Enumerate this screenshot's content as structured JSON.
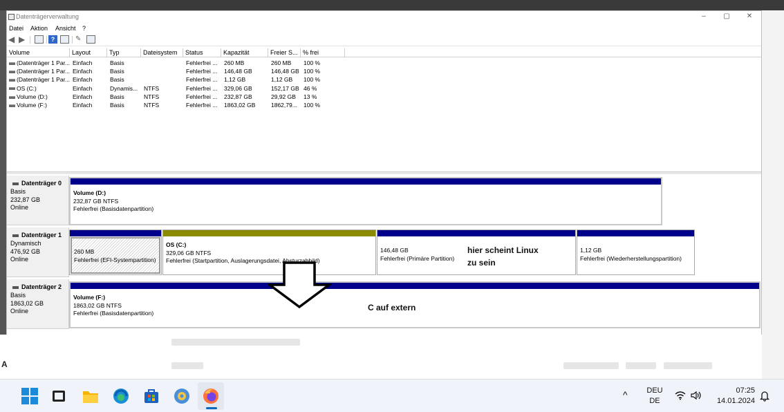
{
  "window": {
    "title": "Datenträgerverwaltung",
    "controls": {
      "minimize": "–",
      "maximize": "▢",
      "close": "✕"
    }
  },
  "menu": [
    "Datei",
    "Aktion",
    "Ansicht",
    "?"
  ],
  "toolbar_icons": [
    "back-icon",
    "forward-icon",
    "console-tree-icon",
    "properties-icon",
    "help-icon",
    "view-icon",
    "connect-icon",
    "settings-icon"
  ],
  "columns": [
    "Volume",
    "Layout",
    "Typ",
    "Dateisystem",
    "Status",
    "Kapazität",
    "Freier S...",
    "% frei"
  ],
  "volumes": [
    {
      "volume": "(Datenträger 1 Par...",
      "layout": "Einfach",
      "typ": "Basis",
      "dateisystem": "",
      "status": "Fehlerfrei ...",
      "kapazitaet": "260 MB",
      "frei": "260 MB",
      "prozent": "100 %"
    },
    {
      "volume": "(Datenträger 1 Par...",
      "layout": "Einfach",
      "typ": "Basis",
      "dateisystem": "",
      "status": "Fehlerfrei ...",
      "kapazitaet": "146,48 GB",
      "frei": "146,48 GB",
      "prozent": "100 %"
    },
    {
      "volume": "(Datenträger 1 Par...",
      "layout": "Einfach",
      "typ": "Basis",
      "dateisystem": "",
      "status": "Fehlerfrei ...",
      "kapazitaet": "1,12 GB",
      "frei": "1,12 GB",
      "prozent": "100 %"
    },
    {
      "volume": "OS (C:)",
      "layout": "Einfach",
      "typ": "Dynamis...",
      "dateisystem": "NTFS",
      "status": "Fehlerfrei ...",
      "kapazitaet": "329,06 GB",
      "frei": "152,17 GB",
      "prozent": "46 %"
    },
    {
      "volume": "Volume (D:)",
      "layout": "Einfach",
      "typ": "Basis",
      "dateisystem": "NTFS",
      "status": "Fehlerfrei ...",
      "kapazitaet": "232,87 GB",
      "frei": "29,92 GB",
      "prozent": "13 %"
    },
    {
      "volume": "Volume (F:)",
      "layout": "Einfach",
      "typ": "Basis",
      "dateisystem": "NTFS",
      "status": "Fehlerfrei ...",
      "kapazitaet": "1863,02 GB",
      "frei": "1862,79...",
      "prozent": "100 %"
    }
  ],
  "disks": [
    {
      "name": "Datenträger 0",
      "type": "Basis",
      "size": "232,87 GB",
      "state": "Online",
      "partitions": [
        {
          "title": "Volume  (D:)",
          "size": "232,87 GB NTFS",
          "status": "Fehlerfrei (Basisdatenpartition)",
          "bar_color": "#00008b"
        }
      ]
    },
    {
      "name": "Datenträger 1",
      "type": "Dynamisch",
      "size": "476,92 GB",
      "state": "Online",
      "partitions": [
        {
          "title": "",
          "size": "260 MB",
          "status": "Fehlerfrei (EFI-Systempartition)",
          "bar_color": "#00008b"
        },
        {
          "title": "OS  (C:)",
          "size": "329,06 GB NTFS",
          "status": "Fehlerfrei (Startpartition, Auslagerungsdatei, Absturzabbild)",
          "bar_color": "#8b8b00"
        },
        {
          "title": "",
          "size": "146,48 GB",
          "status": "Fehlerfrei (Primäre Partition)",
          "bar_color": "#00008b"
        },
        {
          "title": "",
          "size": "1,12 GB",
          "status": "Fehlerfrei (Wiederherstellungspartition)",
          "bar_color": "#00008b"
        }
      ]
    },
    {
      "name": "Datenträger 2",
      "type": "Basis",
      "size": "1863,02 GB",
      "state": "Online",
      "partitions": [
        {
          "title": "Volume  (F:)",
          "size": "1863,02 GB NTFS",
          "status": "Fehlerfrei (Basisdatenpartition)",
          "bar_color": "#00008b"
        }
      ]
    }
  ],
  "annotations": {
    "linux_line1": "hier scheint Linux",
    "linux_line2": "zu sein",
    "c_extern": "C auf extern"
  },
  "desktop": {
    "partial_letter": "A"
  },
  "taskbar": {
    "apps": [
      "windows-start-icon",
      "task-view-icon",
      "file-explorer-icon",
      "edge-icon",
      "store-icon",
      "settings-icon",
      "firefox-icon"
    ],
    "tray_chevron": "^",
    "lang_top": "DEU",
    "lang_bottom": "DE",
    "time": "07:25",
    "date": "14.01.2024"
  }
}
